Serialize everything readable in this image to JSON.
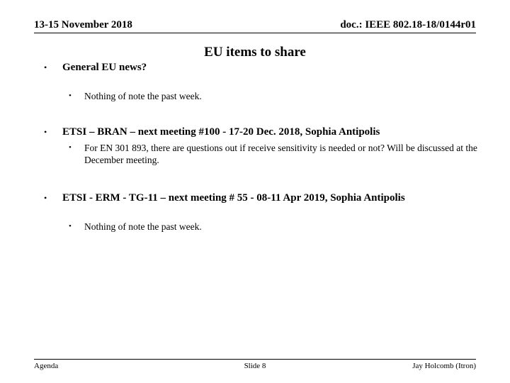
{
  "header": {
    "date": "13-15 November 2018",
    "doc_ref": "doc.: IEEE 802.18-18/0144r01"
  },
  "title": "EU items to share",
  "bullets": [
    {
      "level": 1,
      "marker": "•",
      "text": "General EU news?"
    },
    {
      "level": 2,
      "marker": "•",
      "text": "Nothing of note the past week."
    },
    {
      "level": 1,
      "marker": "•",
      "text": "ETSI – BRAN – next meeting #100 - 17-20 Dec. 2018, Sophia Antipolis"
    },
    {
      "level": 2,
      "marker": "•",
      "text": "For EN 301 893, there are questions out if receive sensitivity is needed or not?  Will be discussed at the December meeting."
    },
    {
      "level": 1,
      "marker": "•",
      "text": "ETSI - ERM - TG-11 – next meeting # 55 - 08-11 Apr 2019, Sophia Antipolis"
    },
    {
      "level": 2,
      "marker": "•",
      "text": "Nothing of note the past week."
    }
  ],
  "footer": {
    "left": "Agenda",
    "center": "Slide 8",
    "right": "Jay Holcomb (Itron)"
  }
}
